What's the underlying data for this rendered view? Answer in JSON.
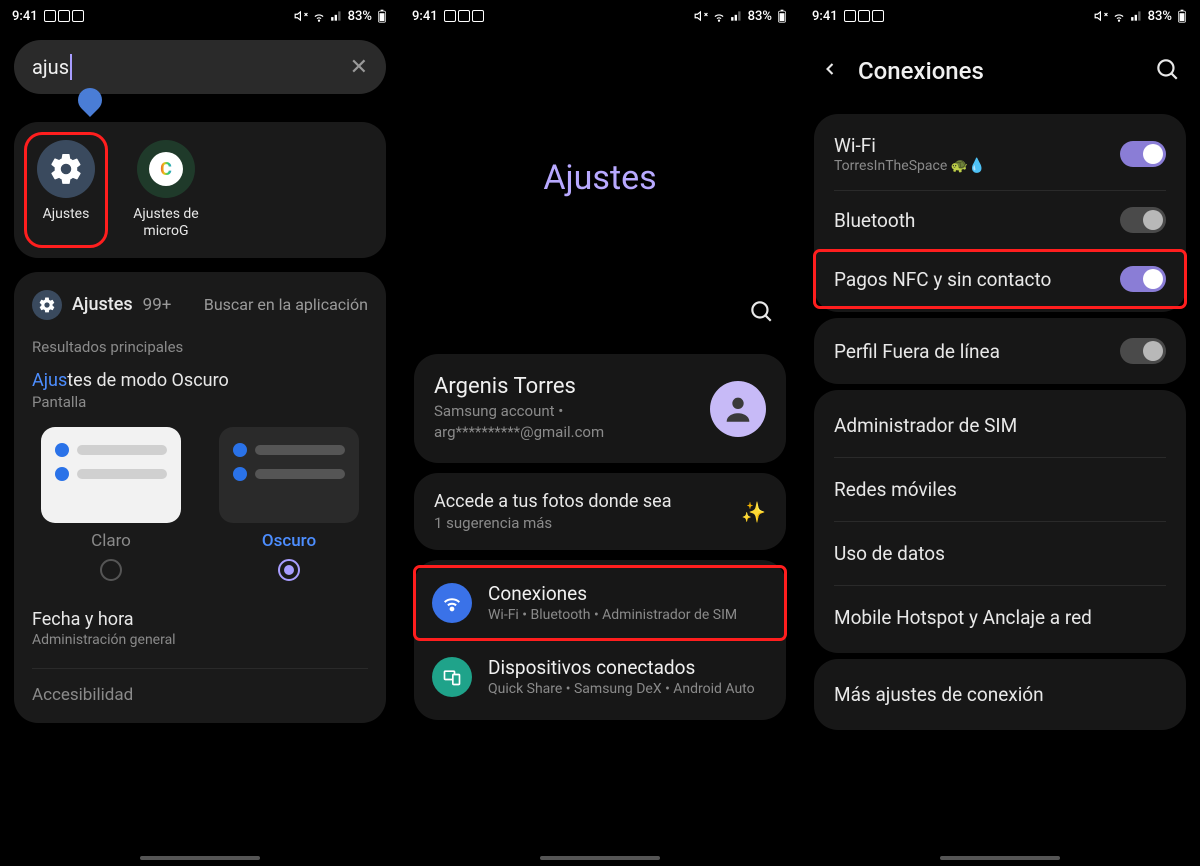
{
  "status": {
    "time": "9:41",
    "battery": "83%"
  },
  "screen1": {
    "search_value": "ajus",
    "apps": [
      {
        "label": "Ajustes"
      },
      {
        "label": "Ajustes de microG"
      }
    ],
    "detail": {
      "title": "Ajustes",
      "count": "99+",
      "action": "Buscar en la aplicación",
      "section_label": "Resultados principales",
      "dark_mode_prefix": "Ajus",
      "dark_mode_rest": "tes de modo Oscuro",
      "dark_mode_sub": "Pantalla",
      "theme_light": "Claro",
      "theme_dark": "Oscuro",
      "row_time_title": "Fecha y hora",
      "row_time_sub": "Administración general",
      "row_accessibility": "Accesibilidad"
    }
  },
  "screen2": {
    "title": "Ajustes",
    "account": {
      "name": "Argenis Torres",
      "sub": "Samsung account  •  arg**********@gmail.com"
    },
    "photos": {
      "title": "Accede a tus fotos donde sea",
      "sub": "1 sugerencia más"
    },
    "rows": [
      {
        "title": "Conexiones",
        "sub": "Wi-Fi  •  Bluetooth  •  Administrador de SIM"
      },
      {
        "title": "Dispositivos conectados",
        "sub": "Quick Share  •  Samsung DeX  •  Android Auto"
      }
    ]
  },
  "screen3": {
    "title": "Conexiones",
    "items_card1": [
      {
        "title": "Wi-Fi",
        "sub": "TorresInTheSpace 🐢💧",
        "toggle": "on"
      },
      {
        "title": "Bluetooth",
        "toggle": "off"
      },
      {
        "title": "Pagos NFC y sin contacto",
        "toggle": "on",
        "highlighted": true
      }
    ],
    "offline": {
      "title": "Perfil Fuera de línea",
      "toggle": "off"
    },
    "items_card3": [
      {
        "title": "Administrador de SIM"
      },
      {
        "title": "Redes móviles"
      },
      {
        "title": "Uso de datos"
      },
      {
        "title": "Mobile Hotspot y Anclaje a red"
      }
    ],
    "more": {
      "title": "Más ajustes de conexión"
    }
  }
}
